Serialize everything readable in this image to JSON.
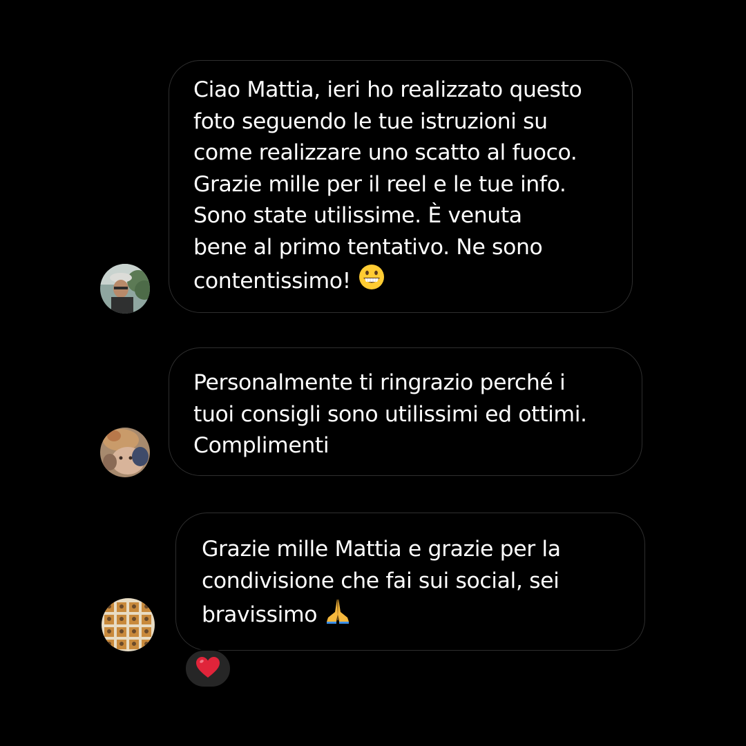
{
  "messages": [
    {
      "text": "Ciao Mattia, ieri ho realizzato questo\nfoto seguendo le tue istruzioni su\ncome realizzare uno scatto al fuoco.\nGrazie mille per il reel e le tue info.\nSono state utilissime. È venuta\nbene al primo tentativo. Ne sono\ncontentissimo!",
      "emoji": "grinning-face-icon"
    },
    {
      "text": "Personalmente ti ringrazio perché i\ntuoi consigli sono utilissimi ed ottimi.\nComplimenti"
    },
    {
      "text": "Grazie mille Mattia e grazie per la\ncondivisione che fai sui social,  sei\nbravissimo",
      "emoji": "folded-hands-icon",
      "reaction": "red-heart-icon"
    }
  ],
  "colors": {
    "background": "#000000",
    "bubble_border": "#2f2f2f",
    "text": "#ffffff",
    "reaction_background": "#262626",
    "heart": "#e0243a"
  }
}
